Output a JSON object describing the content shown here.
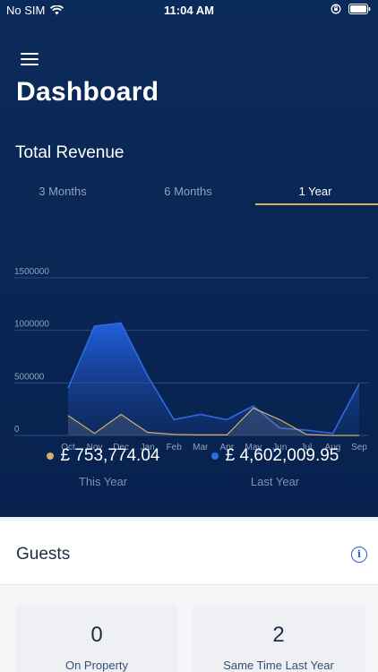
{
  "status": {
    "carrier": "No SIM",
    "time": "11:04 AM",
    "icons": [
      "wifi-icon",
      "orientation-lock-icon",
      "battery-icon"
    ]
  },
  "header": {
    "title": "Dashboard",
    "menu_icon": "hamburger-icon"
  },
  "revenue": {
    "title": "Total Revenue",
    "tabs": [
      {
        "label": "3 Months",
        "active": false
      },
      {
        "label": "6 Months",
        "active": false
      },
      {
        "label": "1 Year",
        "active": true
      }
    ],
    "this_year": {
      "value": "£ 753,774.04",
      "caption": "This Year",
      "color": "#d4b06a"
    },
    "last_year": {
      "value": "£ 4,602,009.95",
      "caption": "Last Year",
      "color": "#2f6be0"
    }
  },
  "chart_data": {
    "type": "area",
    "categories": [
      "Oct",
      "Nov",
      "Dec",
      "Jan",
      "Feb",
      "Mar",
      "Apr",
      "May",
      "Jun",
      "Jul",
      "Aug",
      "Sep"
    ],
    "ylim": [
      0,
      1500000
    ],
    "yticks": [
      "1500000",
      "1000000",
      "500000",
      "0"
    ],
    "grid": true,
    "series": [
      {
        "name": "Last Year",
        "color": "#2f6be0",
        "values": [
          450000,
          1040000,
          1070000,
          570000,
          150000,
          200000,
          150000,
          280000,
          70000,
          50000,
          20000,
          490000
        ]
      },
      {
        "name": "This Year",
        "color": "#d4b06a",
        "values": [
          190000,
          20000,
          200000,
          30000,
          10000,
          5000,
          5000,
          260000,
          150000,
          10000,
          0,
          0
        ]
      }
    ]
  },
  "guests": {
    "title": "Guests",
    "info_icon": "info-icon",
    "cards": [
      {
        "value": "0",
        "label": "On Property"
      },
      {
        "value": "2",
        "label": "Same Time Last Year"
      }
    ]
  }
}
